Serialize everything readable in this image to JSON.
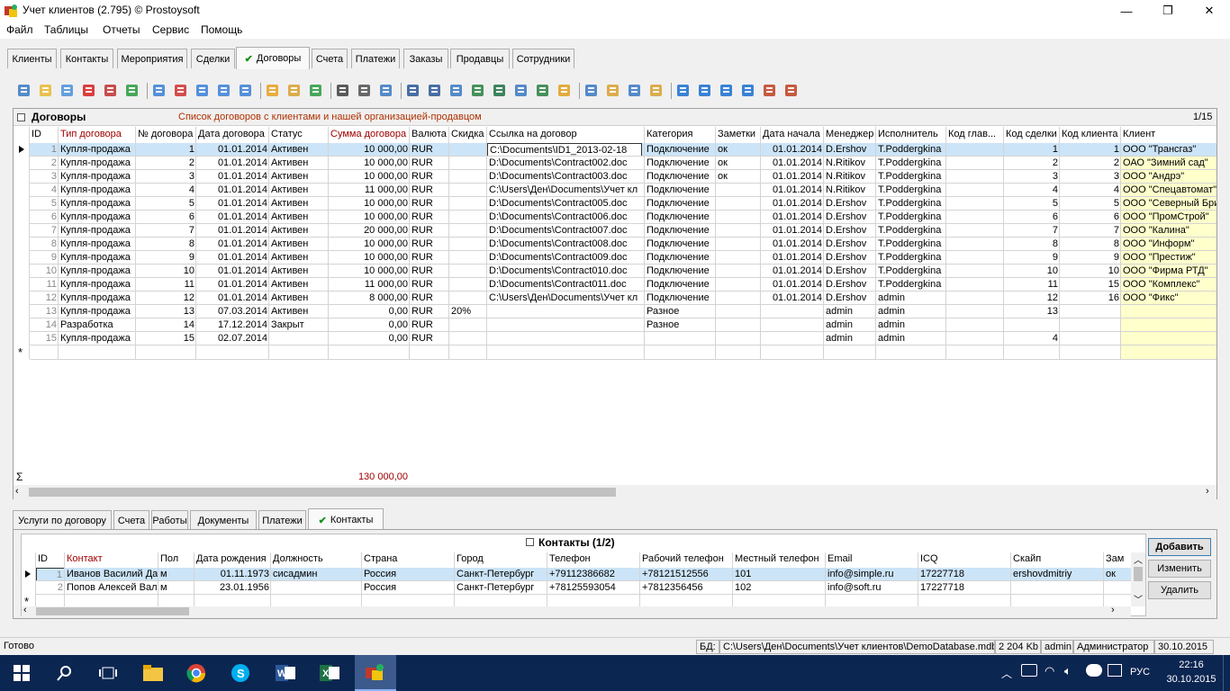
{
  "window": {
    "title": "Учет клиентов (2.795) © Prostoysoft",
    "minimize": "—",
    "maximize": "❐",
    "close": "✕"
  },
  "menu": [
    "Файл",
    "Таблицы",
    "Отчеты",
    "Сервис",
    "Помощь"
  ],
  "tabs": [
    "Клиенты",
    "Контакты",
    "Мероприятия",
    "Сделки",
    "Договоры",
    "Счета",
    "Платежи",
    "Заказы",
    "Продавцы",
    "Сотрудники"
  ],
  "active_tab": "Договоры",
  "grid": {
    "title": "Договоры",
    "subtitle": "Список договоров с клиентами и нашей организацией-продавцом",
    "counter": "1/15",
    "columns": [
      "ID",
      "Тип договора",
      "№ договора",
      "Дата договора",
      "Статус",
      "Сумма договора",
      "Валюта",
      "Скидка",
      "Ссылка на договор",
      "Категория",
      "Заметки",
      "Дата начала",
      "Менеджер",
      "Исполнитель",
      "Код глав...",
      "Код сделки",
      "Код клиента",
      "Клиент"
    ],
    "rows": [
      [
        "1",
        "Купля-продажа",
        "1",
        "01.01.2014",
        "Активен",
        "10 000,00",
        "RUR",
        "",
        "C:\\Documents\\ID1_2013-02-18",
        "Подключение",
        "ок",
        "01.01.2014",
        "D.Ershov",
        "T.Poddergkina",
        "",
        "1",
        "1",
        "ООО \"Трансгаз\""
      ],
      [
        "2",
        "Купля-продажа",
        "2",
        "01.01.2014",
        "Активен",
        "10 000,00",
        "RUR",
        "",
        "D:\\Documents\\Contract002.doc",
        "Подключение",
        "ок",
        "01.01.2014",
        "N.Ritikov",
        "T.Poddergkina",
        "",
        "2",
        "2",
        "ОАО \"Зимний сад\""
      ],
      [
        "3",
        "Купля-продажа",
        "3",
        "01.01.2014",
        "Активен",
        "10 000,00",
        "RUR",
        "",
        "D:\\Documents\\Contract003.doc",
        "Подключение",
        "ок",
        "01.01.2014",
        "N.Ritikov",
        "T.Poddergkina",
        "",
        "3",
        "3",
        "ООО \"Андрэ\""
      ],
      [
        "4",
        "Купля-продажа",
        "4",
        "01.01.2014",
        "Активен",
        "11 000,00",
        "RUR",
        "",
        "C:\\Users\\Ден\\Documents\\Учет кл",
        "Подключение",
        "",
        "01.01.2014",
        "N.Ritikov",
        "T.Poddergkina",
        "",
        "4",
        "4",
        "ООО \"Спецавтомат\""
      ],
      [
        "5",
        "Купля-продажа",
        "5",
        "01.01.2014",
        "Активен",
        "10 000,00",
        "RUR",
        "",
        "D:\\Documents\\Contract005.doc",
        "Подключение",
        "",
        "01.01.2014",
        "D.Ershov",
        "T.Poddergkina",
        "",
        "5",
        "5",
        "ООО \"Северный Бри"
      ],
      [
        "6",
        "Купля-продажа",
        "6",
        "01.01.2014",
        "Активен",
        "10 000,00",
        "RUR",
        "",
        "D:\\Documents\\Contract006.doc",
        "Подключение",
        "",
        "01.01.2014",
        "D.Ershov",
        "T.Poddergkina",
        "",
        "6",
        "6",
        "ООО \"ПромСтрой\""
      ],
      [
        "7",
        "Купля-продажа",
        "7",
        "01.01.2014",
        "Активен",
        "20 000,00",
        "RUR",
        "",
        "D:\\Documents\\Contract007.doc",
        "Подключение",
        "",
        "01.01.2014",
        "D.Ershov",
        "T.Poddergkina",
        "",
        "7",
        "7",
        "ООО \"Калина\""
      ],
      [
        "8",
        "Купля-продажа",
        "8",
        "01.01.2014",
        "Активен",
        "10 000,00",
        "RUR",
        "",
        "D:\\Documents\\Contract008.doc",
        "Подключение",
        "",
        "01.01.2014",
        "D.Ershov",
        "T.Poddergkina",
        "",
        "8",
        "8",
        "ООО \"Информ\""
      ],
      [
        "9",
        "Купля-продажа",
        "9",
        "01.01.2014",
        "Активен",
        "10 000,00",
        "RUR",
        "",
        "D:\\Documents\\Contract009.doc",
        "Подключение",
        "",
        "01.01.2014",
        "D.Ershov",
        "T.Poddergkina",
        "",
        "9",
        "9",
        "ООО \"Престиж\""
      ],
      [
        "10",
        "Купля-продажа",
        "10",
        "01.01.2014",
        "Активен",
        "10 000,00",
        "RUR",
        "",
        "D:\\Documents\\Contract010.doc",
        "Подключение",
        "",
        "01.01.2014",
        "D.Ershov",
        "T.Poddergkina",
        "",
        "10",
        "10",
        "ООО \"Фирма РТД\""
      ],
      [
        "11",
        "Купля-продажа",
        "11",
        "01.01.2014",
        "Активен",
        "11 000,00",
        "RUR",
        "",
        "D:\\Documents\\Contract011.doc",
        "Подключение",
        "",
        "01.01.2014",
        "D.Ershov",
        "T.Poddergkina",
        "",
        "11",
        "15",
        "ООО \"Комплекс\""
      ],
      [
        "12",
        "Купля-продажа",
        "12",
        "01.01.2014",
        "Активен",
        "8 000,00",
        "RUR",
        "",
        "C:\\Users\\Ден\\Documents\\Учет кл",
        "Подключение",
        "",
        "01.01.2014",
        "D.Ershov",
        "admin",
        "",
        "12",
        "16",
        "ООО \"Фикс\""
      ],
      [
        "13",
        "Купля-продажа",
        "13",
        "07.03.2014",
        "Активен",
        "0,00",
        "RUR",
        "20%",
        "",
        "Разное",
        "",
        "",
        "admin",
        "admin",
        "",
        "13",
        "",
        ""
      ],
      [
        "14",
        "Разработка",
        "14",
        "17.12.2014",
        "Закрыт",
        "0,00",
        "RUR",
        "",
        "",
        "Разное",
        "",
        "",
        "admin",
        "admin",
        "",
        "",
        "",
        ""
      ],
      [
        "15",
        "Купля-продажа",
        "15",
        "02.07.2014",
        "",
        "0,00",
        "RUR",
        "",
        "",
        "",
        "",
        "",
        "admin",
        "admin",
        "",
        "4",
        "",
        ""
      ]
    ],
    "total": "130 000,00",
    "sigma": "Σ",
    "new_row": "*"
  },
  "bottom_tabs": [
    "Услуги по договору",
    "Счета",
    "Работы",
    "Документы",
    "Платежи",
    "Контакты"
  ],
  "bottom_active_tab": "Контакты",
  "contacts": {
    "title": "Контакты (1/2)",
    "columns": [
      "ID",
      "Контакт",
      "Пол",
      "Дата рождения",
      "Должность",
      "Страна",
      "Город",
      "Телефон",
      "Рабочий телефон",
      "Местный телефон",
      "Email",
      "ICQ",
      "Скайп",
      "Зам"
    ],
    "rows": [
      [
        "1",
        "Иванов Василий Да",
        "м",
        "01.11.1973",
        "сисадмин",
        "Россия",
        "Санкт-Петербург",
        "+79112386682",
        "+78121512556",
        "101",
        "info@simple.ru",
        "17227718",
        "ershovdmitriy",
        "ок"
      ],
      [
        "2",
        "Попов Алексей Вал",
        "м",
        "23.01.1956",
        "",
        "Россия",
        "Санкт-Петербург",
        "+78125593054",
        "+7812356456",
        "102",
        "info@soft.ru",
        "17227718",
        "",
        ""
      ]
    ],
    "buttons": {
      "add": "Добавить",
      "edit": "Изменить",
      "delete": "Удалить"
    }
  },
  "status": {
    "ready": "Готово",
    "db_label": "БД:",
    "db_path": "C:\\Users\\Ден\\Documents\\Учет клиентов\\DemoDatabase.mdb",
    "size": "2 204 Kb",
    "user": "admin",
    "role": "Администратор",
    "date": "30.10.2015"
  },
  "taskbar": {
    "lang": "РУС",
    "time": "22:16",
    "date": "30.10.2015"
  },
  "colors": {
    "selected_row": "#cce4f7",
    "client_col": "#ffffcc",
    "taskbar": "#0c2652",
    "header_red": "#a00000"
  }
}
